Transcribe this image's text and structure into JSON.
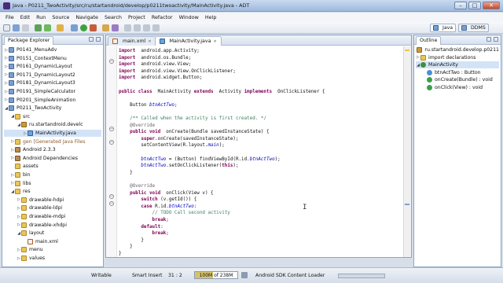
{
  "window": {
    "title": "Java - P0211_TwoActivity/src/ru/startandroid/develop/p0211twoactivity/MainActivity.java - ADT"
  },
  "menubar": [
    "File",
    "Edit",
    "Run",
    "Source",
    "Navigate",
    "Search",
    "Project",
    "Refactor",
    "Window",
    "Help"
  ],
  "perspectives": {
    "java": "Java",
    "ddms": "DDMS"
  },
  "package_explorer": {
    "title": "Package Explorer",
    "items": [
      {
        "label": "P0141_MenuAdv",
        "depth": 0,
        "kind": "proj",
        "twisty": "▷"
      },
      {
        "label": "P0151_ContextMenu",
        "depth": 0,
        "kind": "proj",
        "twisty": "▷"
      },
      {
        "label": "P0161_DynamicLayout",
        "depth": 0,
        "kind": "proj",
        "twisty": "▷"
      },
      {
        "label": "P0171_DynamicLayout2",
        "depth": 0,
        "kind": "proj",
        "twisty": "▷"
      },
      {
        "label": "P0181_DynamicLayout3",
        "depth": 0,
        "kind": "proj",
        "twisty": "▷"
      },
      {
        "label": "P0191_SimpleCalculator",
        "depth": 0,
        "kind": "proj",
        "twisty": "▷"
      },
      {
        "label": "P0201_SimpleAnimation",
        "depth": 0,
        "kind": "proj",
        "twisty": "▷"
      },
      {
        "label": "P0211_TwoActivity",
        "depth": 0,
        "kind": "proj",
        "twisty": "◢"
      },
      {
        "label": "src",
        "depth": 1,
        "kind": "folder",
        "twisty": "◢"
      },
      {
        "label": "ru.startandroid.develc",
        "depth": 2,
        "kind": "pkg",
        "twisty": "◢"
      },
      {
        "label": "MainActivity.java",
        "depth": 3,
        "kind": "java",
        "twisty": "▷",
        "selected": true
      },
      {
        "label": "gen [Generated Java Files",
        "depth": 1,
        "kind": "folder",
        "twisty": "▷",
        "brown": true
      },
      {
        "label": "Android 2.3.3",
        "depth": 1,
        "kind": "lib",
        "twisty": "▷"
      },
      {
        "label": "Android Dependencies",
        "depth": 1,
        "kind": "lib",
        "twisty": "▷"
      },
      {
        "label": "assets",
        "depth": 1,
        "kind": "folder",
        "twisty": ""
      },
      {
        "label": "bin",
        "depth": 1,
        "kind": "folder",
        "twisty": "▷"
      },
      {
        "label": "libs",
        "depth": 1,
        "kind": "folder",
        "twisty": "▷"
      },
      {
        "label": "res",
        "depth": 1,
        "kind": "folder",
        "twisty": "◢"
      },
      {
        "label": "drawable-hdpi",
        "depth": 2,
        "kind": "folder",
        "twisty": "▷"
      },
      {
        "label": "drawable-ldpi",
        "depth": 2,
        "kind": "folder",
        "twisty": "▷"
      },
      {
        "label": "drawable-mdpi",
        "depth": 2,
        "kind": "folder",
        "twisty": "▷"
      },
      {
        "label": "drawable-xhdpi",
        "depth": 2,
        "kind": "folder",
        "twisty": "▷"
      },
      {
        "label": "layout",
        "depth": 2,
        "kind": "folder",
        "twisty": "◢"
      },
      {
        "label": "main.xml",
        "depth": 3,
        "kind": "xml",
        "twisty": ""
      },
      {
        "label": "menu",
        "depth": 2,
        "kind": "folder",
        "twisty": "▷"
      },
      {
        "label": "values",
        "depth": 2,
        "kind": "folder",
        "twisty": "▷"
      }
    ]
  },
  "editor": {
    "tabs": [
      {
        "label": "main.xml",
        "active": false
      },
      {
        "label": "MainActivity.java",
        "active": true
      }
    ],
    "lines": [
      [
        [
          "kw",
          "import"
        ],
        [
          "",
          "  android.app.Activity;"
        ]
      ],
      [
        [
          "kw",
          "import"
        ],
        [
          "",
          "  android.os.Bundle;"
        ]
      ],
      [
        [
          "kw",
          "import"
        ],
        [
          "",
          "  android.view.View;"
        ]
      ],
      [
        [
          "kw",
          "import"
        ],
        [
          "",
          "  android.view.View.OnClickListener;"
        ]
      ],
      [
        [
          "kw",
          "import"
        ],
        [
          "",
          "  android.widget.Button;"
        ]
      ],
      [],
      [
        [
          "kw",
          "public class"
        ],
        [
          "",
          "  MainActivity "
        ],
        [
          "kw",
          "extends"
        ],
        [
          "",
          "  Activity "
        ],
        [
          "kw",
          "implements"
        ],
        [
          "",
          "  OnClickListener {"
        ]
      ],
      [],
      [
        [
          "",
          "    Button "
        ],
        [
          "fld",
          "btnActTwo"
        ],
        [
          "",
          ";"
        ]
      ],
      [],
      [
        [
          "cm",
          "    /** Called when the activity is first created. */"
        ]
      ],
      [
        [
          "an",
          "    @Override"
        ]
      ],
      [
        [
          "kw",
          "    public void"
        ],
        [
          "",
          "  onCreate(Bundle savedInstanceState) {"
        ]
      ],
      [
        [
          "kw",
          "        super"
        ],
        [
          "",
          ".onCreate(savedInstanceState);"
        ]
      ],
      [
        [
          "",
          "        setContentView(R.layout."
        ],
        [
          "fld",
          "main"
        ],
        [
          "",
          ");"
        ]
      ],
      [],
      [
        [
          "",
          "        "
        ],
        [
          "fld",
          "btnActTwo"
        ],
        [
          "",
          " = (Button) findViewById(R.id."
        ],
        [
          "fld",
          "btnActTwo"
        ],
        [
          "",
          ");"
        ]
      ],
      [
        [
          "",
          "        "
        ],
        [
          "fld",
          "btnActTwo"
        ],
        [
          "",
          ".setOnClickListener("
        ],
        [
          "kw",
          "this"
        ],
        [
          "",
          ");"
        ]
      ],
      [
        [
          "",
          "    }"
        ]
      ],
      [],
      [
        [
          "an",
          "    @Override"
        ]
      ],
      [
        [
          "kw",
          "    public void"
        ],
        [
          "",
          "  onClick(View v) {"
        ]
      ],
      [
        [
          "kw",
          "        switch"
        ],
        [
          "",
          " (v.getId()) {"
        ]
      ],
      [
        [
          "kw",
          "        case"
        ],
        [
          "",
          " R.id."
        ],
        [
          "fld",
          "btnActTwo"
        ],
        [
          "",
          ":"
        ]
      ],
      [
        [
          "cm",
          "            // TODO Call second activity"
        ]
      ],
      [
        [
          "kw",
          "            break"
        ],
        [
          "",
          ";"
        ]
      ],
      [
        [
          "kw",
          "        default"
        ],
        [
          "",
          ":"
        ]
      ],
      [
        [
          "kw",
          "            break"
        ],
        [
          "",
          ";"
        ]
      ],
      [
        [
          "",
          "        }"
        ]
      ],
      [
        [
          "",
          "    }"
        ]
      ],
      [
        [
          "",
          "}"
        ]
      ]
    ]
  },
  "outline": {
    "title": "Outline",
    "items": [
      {
        "label": "ru.startandroid.develop.p0211",
        "depth": 0,
        "kind": "pkg",
        "twisty": ""
      },
      {
        "label": "import declarations",
        "depth": 0,
        "kind": "folder",
        "twisty": "▷"
      },
      {
        "label": "MainActivity",
        "depth": 0,
        "kind": "class",
        "twisty": "◢",
        "selected": true
      },
      {
        "label": "btnActTwo : Button",
        "depth": 1,
        "kind": "field",
        "twisty": ""
      },
      {
        "label": "onCreate(Bundle) : void",
        "depth": 1,
        "kind": "method",
        "twisty": ""
      },
      {
        "label": "onClick(View) : void",
        "depth": 1,
        "kind": "method",
        "twisty": ""
      }
    ]
  },
  "statusbar": {
    "mode": "Writable",
    "insert": "Smart Insert",
    "position": "31 : 2",
    "heap": "100M of 238M",
    "heap_used_fraction": 0.42,
    "task": "Android SDK Content Loader"
  }
}
